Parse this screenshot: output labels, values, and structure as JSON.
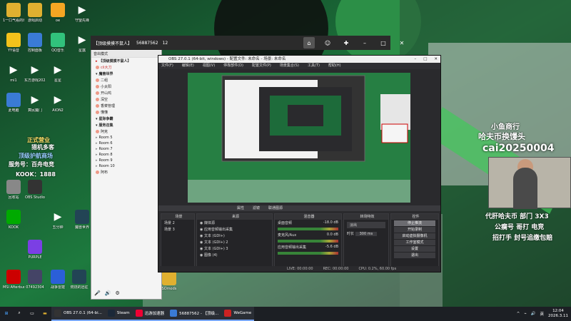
{
  "desktop_icons": [
    {
      "label": "1一口气看的动漫大合集",
      "icon": "folder",
      "color": "#e0b030"
    },
    {
      "label": "游戏启动",
      "icon": "folder",
      "color": "#e0b030"
    },
    {
      "label": "oe",
      "icon": "overwatch",
      "color": "#f5a623"
    },
    {
      "label": "守望先锋",
      "icon": "wav-player",
      "color": "#2bb673"
    },
    {
      "label": "YY语音",
      "icon": "yy-owl",
      "color": "#f3c21b"
    },
    {
      "label": "控制面板",
      "icon": "control-panel",
      "color": "#3a7bd5"
    },
    {
      "label": "QQ音乐",
      "icon": "qq-music",
      "color": "#31c27c"
    },
    {
      "label": "星露",
      "icon": "wav-player",
      "color": "#2bb673"
    },
    {
      "label": "mi1",
      "icon": "play",
      "color": "#2bb673"
    },
    {
      "label": "东方游戏20250601",
      "icon": "play",
      "color": "#2bb673"
    },
    {
      "label": "星星",
      "icon": "wav-player",
      "color": "#2bb673"
    },
    {
      "label": "此电脑",
      "icon": "computer",
      "color": "#3a7bd5"
    },
    {
      "label": "算民魔门",
      "icon": "play",
      "color": "#2bb673"
    },
    {
      "label": "AION2",
      "icon": "play",
      "color": "#2bb673"
    },
    {
      "label": "OBS Studio",
      "icon": "obs",
      "color": "#333"
    },
    {
      "label": "KOOK",
      "icon": "kook",
      "color": "#0a0"
    },
    {
      "label": "回收站",
      "icon": "recycle",
      "color": "#888"
    },
    {
      "label": "PURPLE",
      "icon": "purple",
      "color": "#7b3fe4"
    },
    {
      "label": "MSI Afterburner",
      "icon": "msi",
      "color": "#c00"
    },
    {
      "label": "07492304",
      "icon": "image",
      "color": "#446"
    },
    {
      "label": "战争雷霆",
      "icon": "g",
      "color": "#2b5fd8"
    },
    {
      "label": "燃烧的远征",
      "icon": "wow",
      "color": "#245"
    },
    {
      "label": "五分钟",
      "icon": "wav-player",
      "color": "#2bb673"
    },
    {
      "label": "魔兽世界",
      "icon": "wow",
      "color": "#245"
    },
    {
      "label": "无畏契约 WeGame版",
      "icon": "valorant",
      "color": "#fff"
    },
    {
      "label": "昆仑",
      "icon": "avatar",
      "color": "#d55"
    },
    {
      "label": "PotPlayer 64 bit",
      "icon": "potplayer",
      "color": "#f5c518"
    },
    {
      "label": "SOmods",
      "icon": "folder",
      "color": "#e0b030"
    }
  ],
  "chat_window": {
    "title": "【顶级摸摸不鼠人】",
    "room_id": "56887562",
    "member_count": "12",
    "channel_name": "【顶级摸摸不鼠人】",
    "sub_label": "音出模式",
    "top_user": "cli大刀",
    "section": "魔兽世界",
    "users": [
      "二组",
      "小太阳",
      "开山鸡",
      "深空",
      "香菜管理",
      "懂懂"
    ],
    "section2": "星际争霸",
    "section3": "服务召集",
    "rooms": [
      "Room 5",
      "Room 6",
      "Room 7",
      "Room 8",
      "Room 9",
      "Room 10"
    ],
    "user_bottom": "阿克",
    "user_bottom2": "阿布"
  },
  "obs": {
    "title": "OBS 27.0.1 (64-bit, windows) - 配置文件: 未命名 - 场景: 未命名",
    "menu": [
      "文件(F)",
      "编辑(E)",
      "视图(V)",
      "停靠部件(D)",
      "配置文件(P)",
      "场景集合(S)",
      "工具(T)",
      "帮助(H)"
    ],
    "scene_bar": [
      "属性",
      "滤镜",
      "联通图源"
    ],
    "scenes_header": "场景",
    "scenes": [
      "场景 2",
      "场景 3"
    ],
    "sources_header": "来源",
    "sources": [
      "媒体源",
      "应用音频输出采集",
      "文本 (GDI+)",
      "文本 (GDI+) 2",
      "文本 (GDI+) 3",
      "图像 (4)"
    ],
    "mixer_header": "混音器",
    "mixer": [
      {
        "name": "桌面音频",
        "db": "-18.0 dB"
      },
      {
        "name": "麦克风/Aux",
        "db": "0.0 dB"
      },
      {
        "name": "应用音频输出采集",
        "db": "-5.6 dB"
      }
    ],
    "transition_header": "转场特效",
    "transition_type": "淡出",
    "transition_duration_label": "时长",
    "transition_duration": "300 ms",
    "controls_header": "控件",
    "controls": [
      "停止推流",
      "开始录制",
      "启动虚拟摄像机",
      "工作室模式",
      "设置",
      "退出"
    ],
    "status": {
      "live": "LIVE: 00:00:00",
      "rec": "REC: 00:00:00",
      "cpu": "CPU: 0.2%, 60.00 fps"
    }
  },
  "overlay": {
    "line1": "小鱼商行",
    "line2": "哈夫币换馒头",
    "line3": "cai20250004",
    "info1": "代肝哈夫币 部门 3X3",
    "info2": "公瘸号 哥打 电竞",
    "info3": "招打手 封号追缴包赔",
    "left_tag1": "正式营业",
    "left_tag2": "猎机多客",
    "left_tag3": "顶级护航商场",
    "left_tag4": "服务号：百舟电竞",
    "left_tag5": "KOOK：1888"
  },
  "taskbar": {
    "apps": [
      {
        "label": "OBS 27.0.1 (64-bi...",
        "icon": "obs"
      },
      {
        "label": "Steam",
        "icon": "steam"
      },
      {
        "label": "迅游加速器",
        "icon": "xunyou"
      },
      {
        "label": "56887562 - 【顶级...",
        "icon": "chat"
      },
      {
        "label": "WeGame",
        "icon": "wegame"
      }
    ],
    "lang": "英",
    "time": "12:04",
    "date": "2026.3.11"
  },
  "colors": {
    "accent": "#2bb673",
    "obs_bg": "#2a2a2d",
    "taskbar": "#1c1f24"
  }
}
